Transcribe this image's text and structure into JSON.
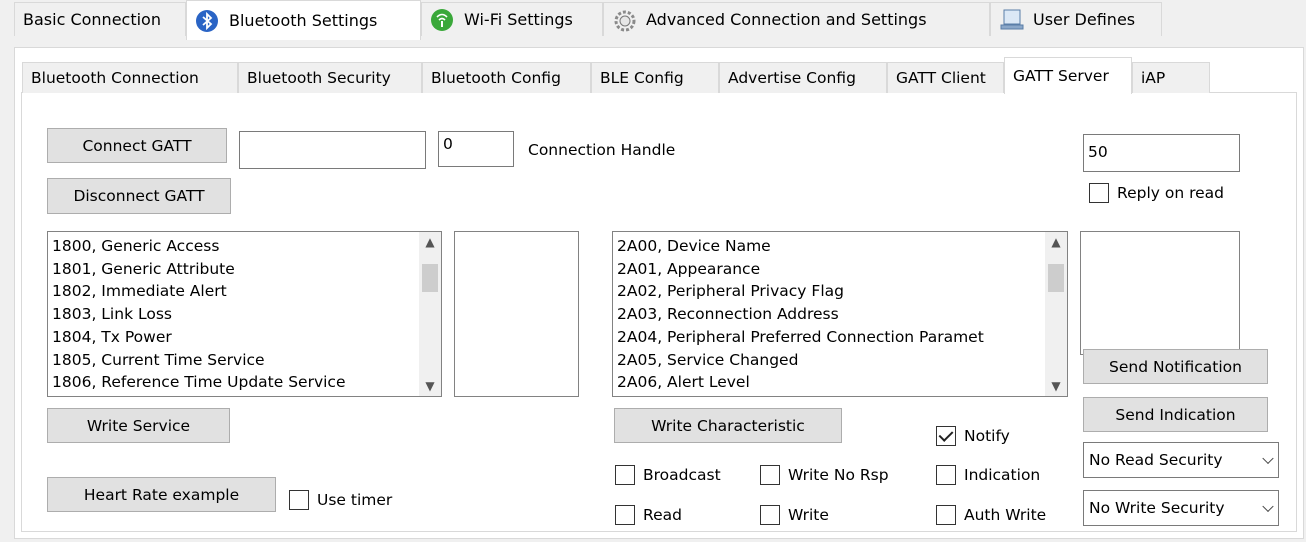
{
  "top_tabs": [
    {
      "label": "Basic Connection",
      "icon": "none"
    },
    {
      "label": "Bluetooth Settings",
      "icon": "bluetooth-icon"
    },
    {
      "label": "Wi-Fi Settings",
      "icon": "wifi-icon"
    },
    {
      "label": "Advanced Connection and Settings",
      "icon": "gear-icon"
    },
    {
      "label": "User Defines",
      "icon": "monitor-icon"
    }
  ],
  "sub_tabs": [
    "Bluetooth Connection",
    "Bluetooth Security",
    "Bluetooth Config",
    "BLE Config",
    "Advertise Config",
    "GATT Client",
    "GATT Server",
    "iAP"
  ],
  "gatt": {
    "connect_label": "Connect GATT",
    "disconnect_label": "Disconnect GATT",
    "address_value": "",
    "handle_value": "0",
    "handle_label": "Connection Handle",
    "right_value": "50",
    "reply_on_read": "Reply on read"
  },
  "services": [
    "1800, Generic Access",
    "1801, Generic Attribute",
    "1802, Immediate Alert",
    "1803, Link Loss",
    "1804, Tx Power",
    "1805, Current Time Service",
    "1806, Reference Time Update Service"
  ],
  "characteristics": [
    "2A00, Device Name",
    "2A01, Appearance",
    "2A02, Peripheral Privacy Flag",
    "2A03, Reconnection Address",
    "2A04, Peripheral Preferred Connection Paramet",
    "2A05, Service Changed",
    "2A06, Alert Level"
  ],
  "buttons": {
    "write_service": "Write Service",
    "write_characteristic": "Write Characteristic",
    "heart_rate": "Heart Rate example",
    "send_notification": "Send Notification",
    "send_indication": "Send Indication"
  },
  "checkboxes": {
    "use_timer": "Use timer",
    "broadcast": "Broadcast",
    "read": "Read",
    "write_no_rsp": "Write No Rsp",
    "write": "Write",
    "notify": "Notify",
    "indication": "Indication",
    "auth_write": "Auth Write"
  },
  "combos": {
    "read_security": "No Read Security",
    "write_security": "No Write Security"
  }
}
